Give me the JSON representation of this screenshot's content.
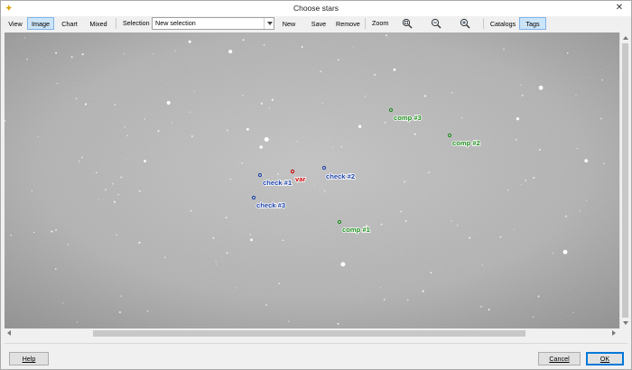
{
  "window": {
    "title": "Choose stars"
  },
  "toolbar": {
    "view_label": "View",
    "image_label": "Image",
    "chart_label": "Chart",
    "mixed_label": "Mixed",
    "selection_label": "Selection",
    "selection_value": "New selection",
    "new_label": "New",
    "save_as_label": "Save as...",
    "remove_label": "Remove",
    "zoom_label": "Zoom",
    "catalogs_label": "Catalogs",
    "tags_label": "Tags",
    "active_view": "Image",
    "tags_active": true
  },
  "stars": [
    {
      "label": "var",
      "color": "#cc0000"
    },
    {
      "label": "check #1",
      "color": "#1a3fa8"
    },
    {
      "label": "check #2",
      "color": "#1a3fa8"
    },
    {
      "label": "check #3",
      "color": "#1a3fa8"
    },
    {
      "label": "comp #1",
      "color": "#1a8c1a"
    },
    {
      "label": "comp #2",
      "color": "#1a8c1a"
    },
    {
      "label": "comp #3",
      "color": "#1a8c1a"
    }
  ],
  "buttons": {
    "help": "Help",
    "cancel": "Cancel",
    "ok": "OK"
  },
  "icons": {
    "app": "star-icon",
    "close": "close-icon",
    "zoom": [
      "zoom-fit-icon",
      "zoom-out-icon",
      "zoom-in-icon"
    ]
  }
}
